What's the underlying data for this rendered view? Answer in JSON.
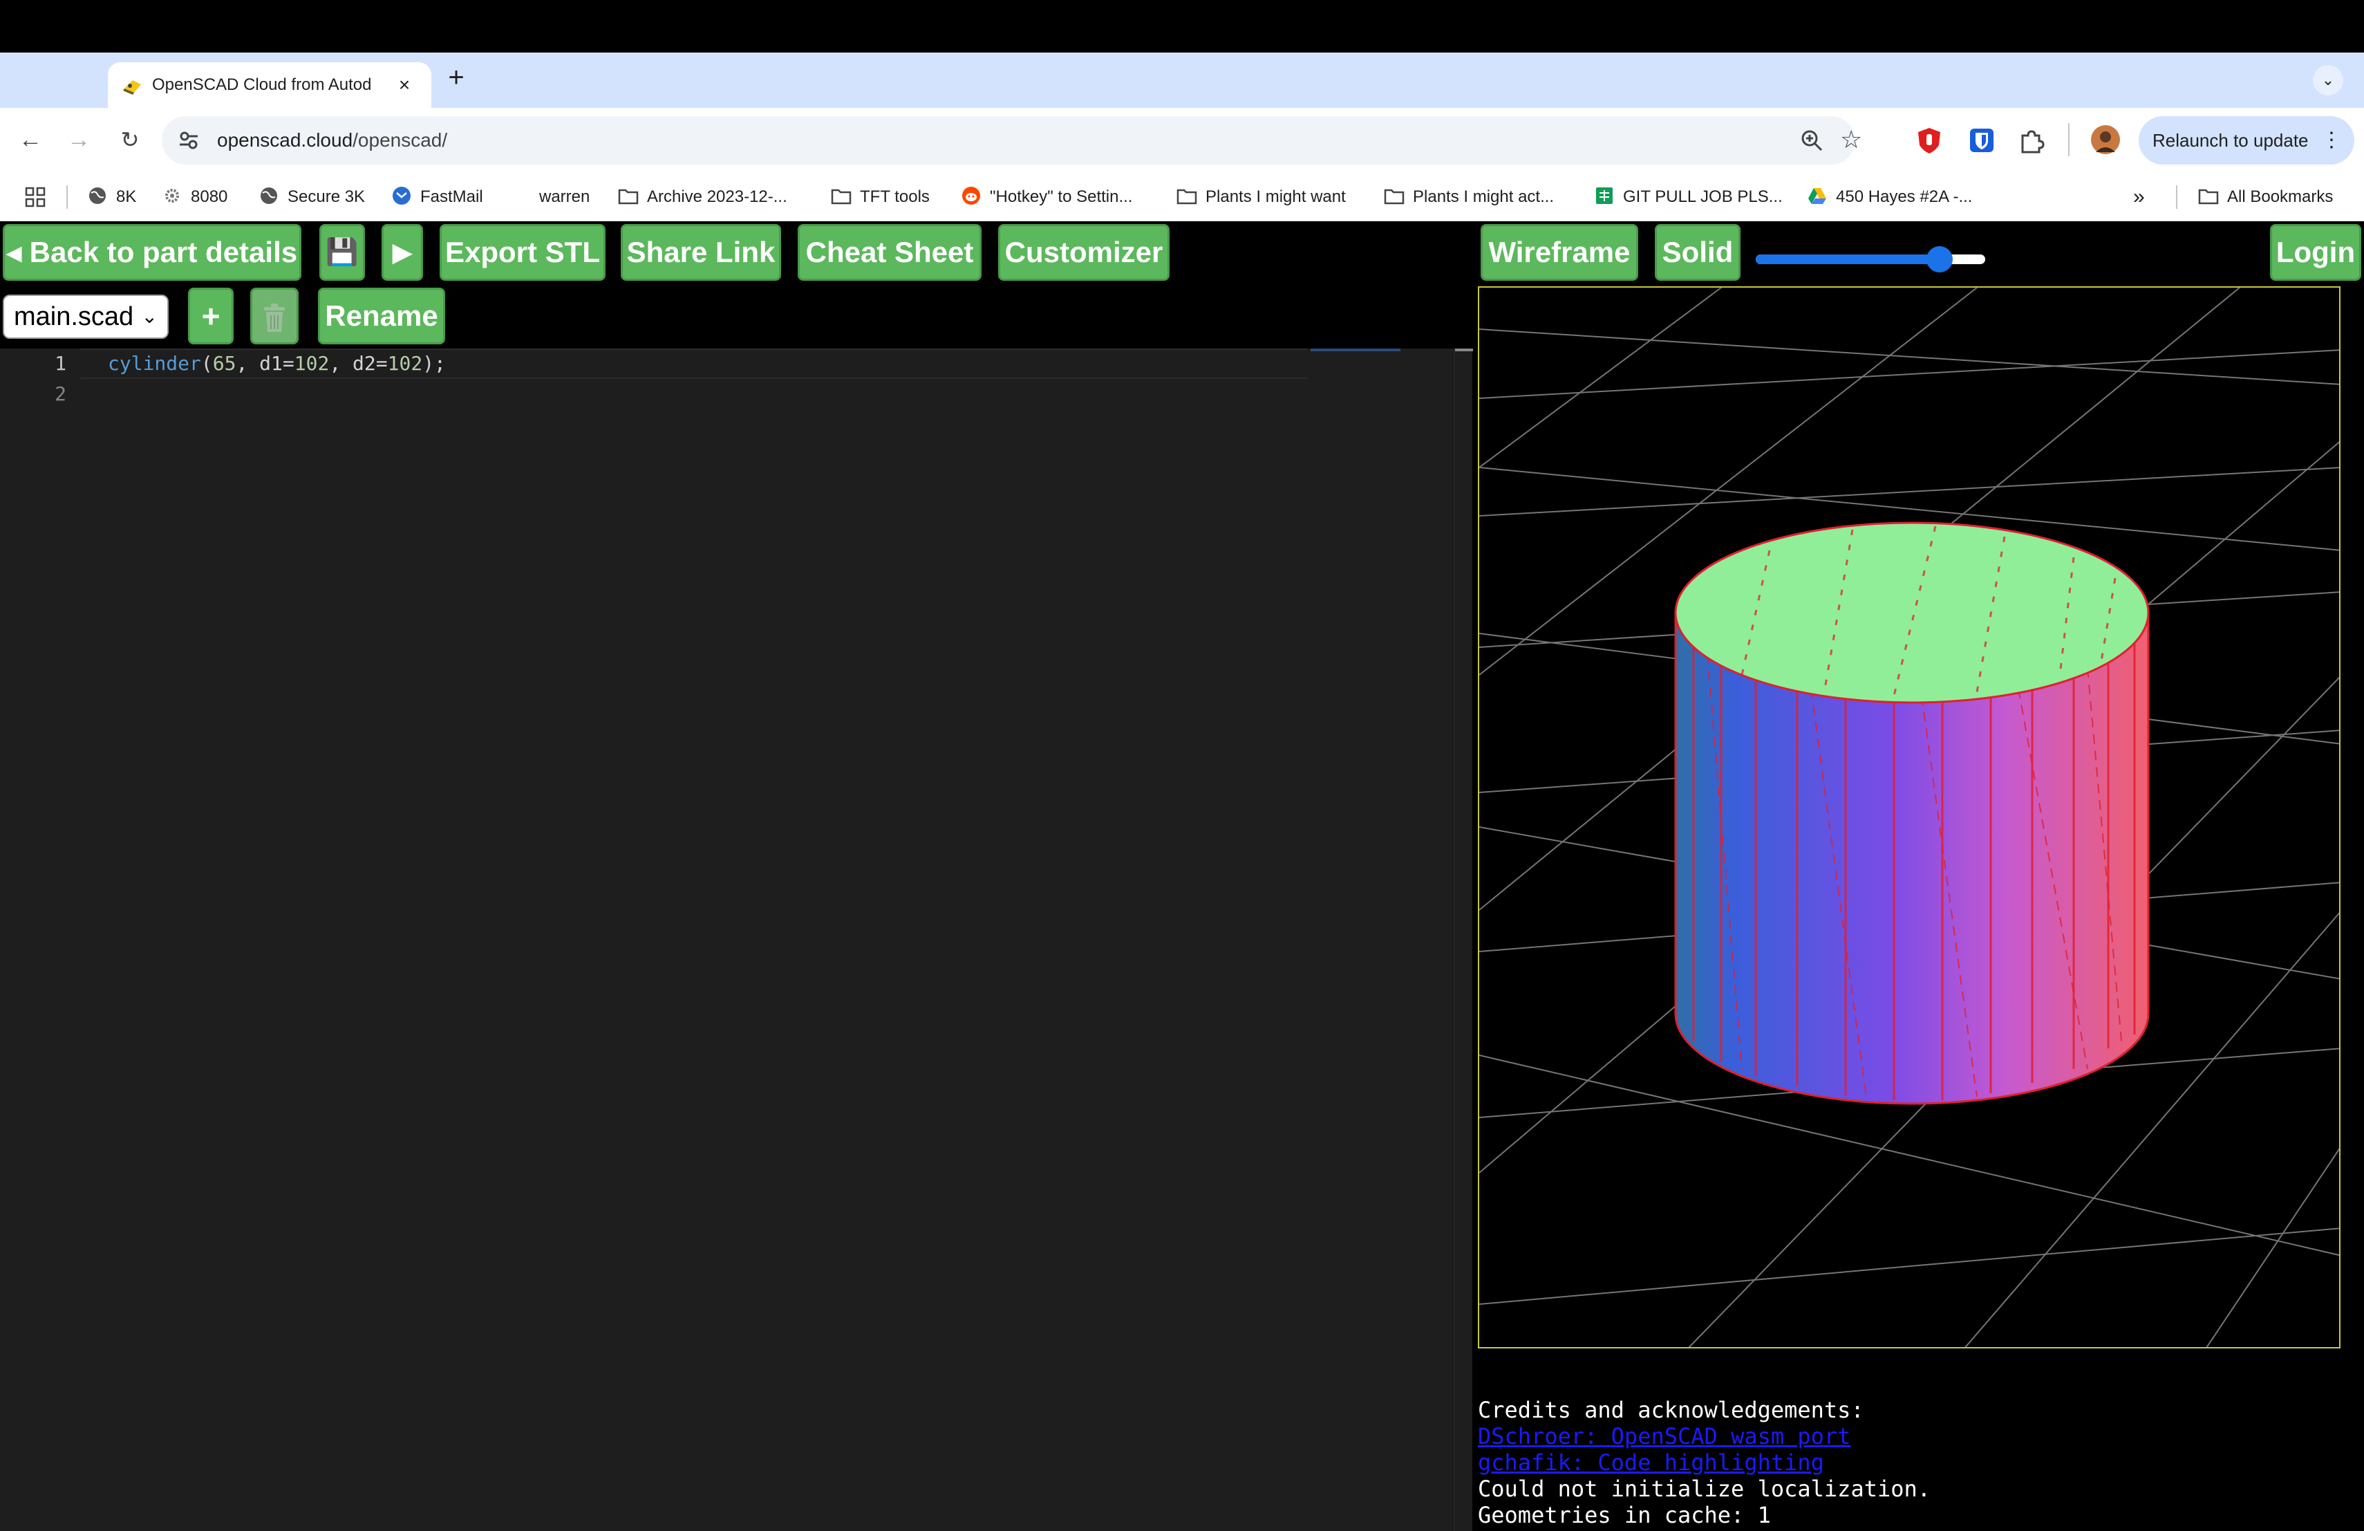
{
  "browser": {
    "tab_title": "OpenSCAD Cloud from Autod",
    "url_host": "openscad.cloud",
    "url_path": "/openscad/",
    "relaunch_label": "Relaunch to update",
    "bookmarks": [
      {
        "label": "8K",
        "icon": "globe-icon"
      },
      {
        "label": "8080",
        "icon": "gear-icon"
      },
      {
        "label": "Secure 3K",
        "icon": "globe-icon"
      },
      {
        "label": "FastMail",
        "icon": "mail-icon"
      },
      {
        "label": "warren",
        "icon": "none"
      },
      {
        "label": "Archive 2023-12-...",
        "icon": "folder-icon"
      },
      {
        "label": "TFT tools",
        "icon": "folder-icon"
      },
      {
        "label": "\"Hotkey\" to Settin...",
        "icon": "reddit-icon"
      },
      {
        "label": "Plants I might want",
        "icon": "folder-icon"
      },
      {
        "label": "Plants I might act...",
        "icon": "folder-icon"
      },
      {
        "label": "GIT PULL JOB PLS...",
        "icon": "sheets-icon"
      },
      {
        "label": "450 Hayes #2A -...",
        "icon": "drive-icon"
      }
    ],
    "overflow_label": "»",
    "all_bookmarks_label": "All Bookmarks"
  },
  "app": {
    "toolbar": {
      "back_label": "◂ Back to part details",
      "save_icon": "💾",
      "run_icon": "▶",
      "export_label": "Export STL",
      "share_label": "Share Link",
      "cheat_label": "Cheat Sheet",
      "customizer_label": "Customizer",
      "wireframe_label": "Wireframe",
      "solid_label": "Solid",
      "login_label": "Login",
      "slider_value": 0.84
    },
    "files": {
      "selected": "main.scad",
      "add_label": "+",
      "rename_label": "Rename"
    },
    "editor": {
      "line_numbers": [
        "1",
        "2"
      ],
      "code_fn": "cylinder",
      "code_args": [
        "65",
        "102",
        "102"
      ]
    },
    "console": {
      "heading": "Credits and acknowledgements:",
      "link1": "DSchroer: OpenSCAD wasm port",
      "link2": "gchafik: Code highlighting ",
      "line1": "Could not initialize localization.",
      "line2": "Geometries in cache: 1"
    },
    "colors": {
      "button_green": "#5cb85c",
      "cylinder_top": "#90ee98",
      "cylinder_side_left": "#3a5fd9",
      "cylinder_side_right": "#f06070",
      "edge_red": "#e02030",
      "viewer_border": "#c8c83a"
    }
  }
}
